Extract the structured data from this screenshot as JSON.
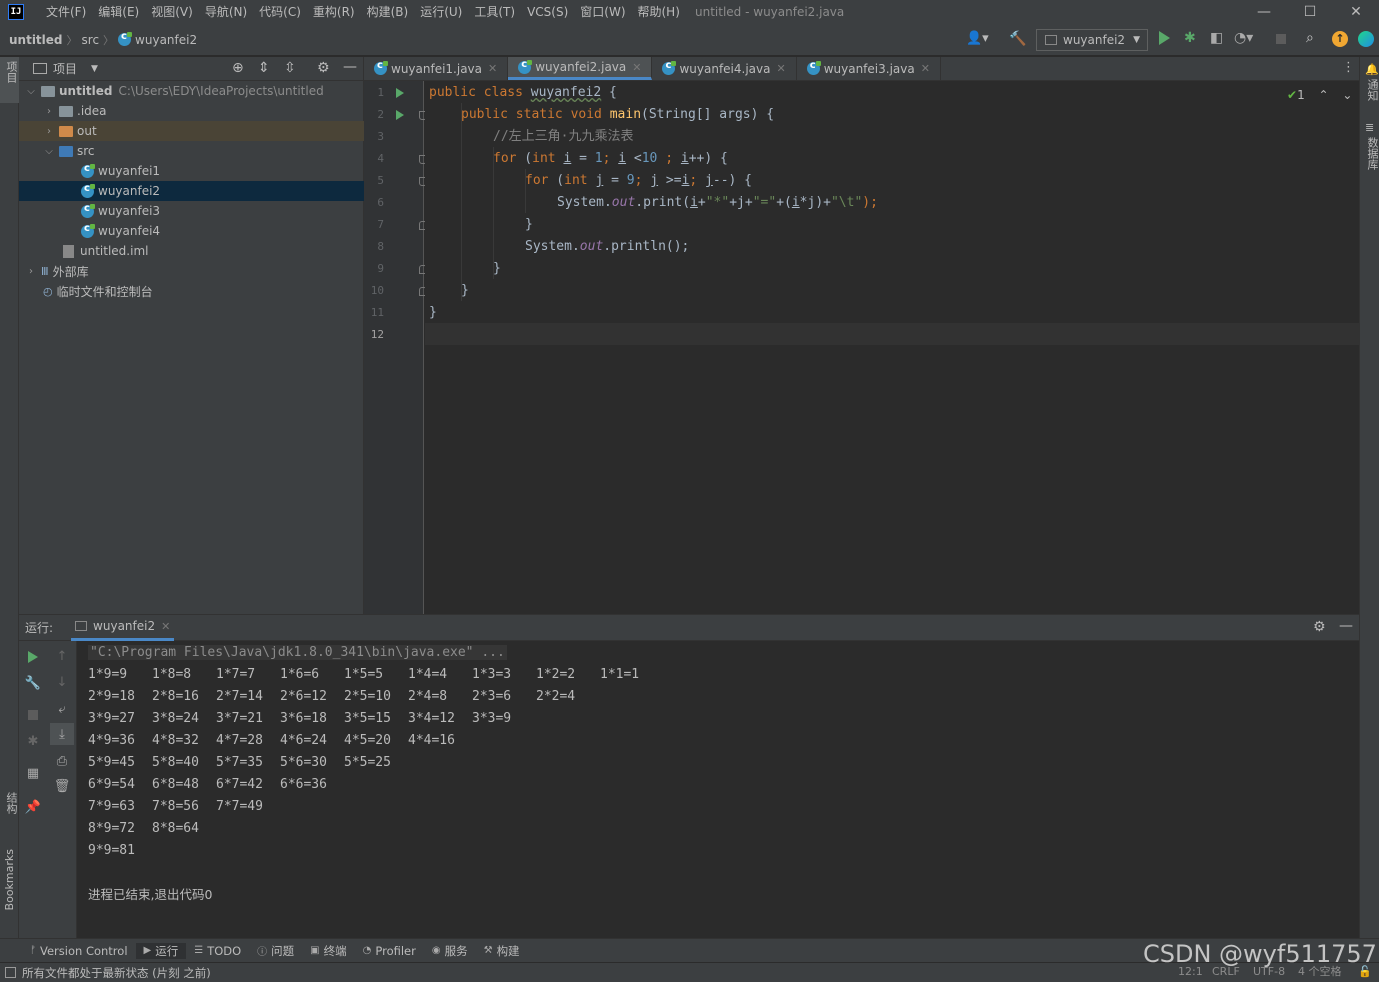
{
  "app": {
    "logo_text": "IJ",
    "window_title": "untitled - wuyanfei2.java"
  },
  "menu": [
    "文件(F)",
    "编辑(E)",
    "视图(V)",
    "导航(N)",
    "代码(C)",
    "重构(R)",
    "构建(B)",
    "运行(U)",
    "工具(T)",
    "VCS(S)",
    "窗口(W)",
    "帮助(H)"
  ],
  "breadcrumb": {
    "project": "untitled",
    "folder": "src",
    "file": "wuyanfei2"
  },
  "run_config": {
    "label": "wuyanfei2"
  },
  "stripes": {
    "left_top": "项目",
    "left_structure": "结构",
    "left_bookmarks": "Bookmarks",
    "right_notifications": "通知",
    "right_database": "数据库"
  },
  "project_panel": {
    "title": "项目",
    "tree": [
      {
        "label": "untitled",
        "path": "C:\\Users\\EDY\\IdeaProjects\\untitled"
      },
      {
        "label": ".idea"
      },
      {
        "label": "out"
      },
      {
        "label": "src"
      },
      {
        "label": "wuyanfei1"
      },
      {
        "label": "wuyanfei2"
      },
      {
        "label": "wuyanfei3"
      },
      {
        "label": "wuyanfei4"
      },
      {
        "label": "untitled.iml"
      },
      {
        "label": "外部库"
      },
      {
        "label": "临时文件和控制台"
      }
    ]
  },
  "editor": {
    "tabs": [
      "wuyanfei1.java",
      "wuyanfei2.java",
      "wuyanfei4.java",
      "wuyanfei3.java"
    ],
    "inspection_count": "1",
    "line_numbers": [
      "1",
      "2",
      "3",
      "4",
      "5",
      "6",
      "7",
      "8",
      "9",
      "10",
      "11",
      "12"
    ],
    "code": {
      "l1_kw": "public class ",
      "l1_name": "wuyanfei2",
      "l1_rest": " {",
      "l2_kw": "public static void ",
      "l2_fn": "main",
      "l2_rest": "(String[] args) {",
      "l3_comment": "//左上三角·九九乘法表",
      "l4_for": "for",
      "l4_a": " (",
      "l4_int": "int",
      "l4_b": " ",
      "l4_i1": "i",
      "l4_c": " = ",
      "l4_n1": "1",
      "l4_d": "; ",
      "l4_i2": "i",
      "l4_e": " <",
      "l4_n2": "10",
      "l4_f": " ; ",
      "l4_i3": "i",
      "l4_g": "++) {",
      "l5_for": "for",
      "l5_a": " (",
      "l5_int": "int",
      "l5_b": " ",
      "l5_j1": "j",
      "l5_c": " = ",
      "l5_n1": "9",
      "l5_d": "; ",
      "l5_j2": "j",
      "l5_e": " >=",
      "l5_i": "i",
      "l5_f": "; ",
      "l5_j3": "j",
      "l5_g": "--) {",
      "l6_sys": "System.",
      "l6_out": "out",
      "l6_print": ".print(",
      "l6_i": "i",
      "l6_p1": "+",
      "l6_s1": "\"*\"",
      "l6_p2": "+j+",
      "l6_s2": "\"=\"",
      "l6_p3": "+(",
      "l6_i2": "i",
      "l6_p4": "*j)+",
      "l6_s3": "\"\\t\"",
      "l6_end": ");",
      "l7": "}",
      "l8_sys": "System.",
      "l8_out": "out",
      "l8_rest": ".println();",
      "l9": "}",
      "l10": "}",
      "l11": "}"
    }
  },
  "run_panel": {
    "label": "运行:",
    "tab": "wuyanfei2",
    "command": "\"C:\\Program Files\\Java\\jdk1.8.0_341\\bin\\java.exe\" ...",
    "output": [
      [
        "1*9=9",
        "1*8=8",
        "1*7=7",
        "1*6=6",
        "1*5=5",
        "1*4=4",
        "1*3=3",
        "1*2=2",
        "1*1=1"
      ],
      [
        "2*9=18",
        "2*8=16",
        "2*7=14",
        "2*6=12",
        "2*5=10",
        "2*4=8",
        "2*3=6",
        "2*2=4"
      ],
      [
        "3*9=27",
        "3*8=24",
        "3*7=21",
        "3*6=18",
        "3*5=15",
        "3*4=12",
        "3*3=9"
      ],
      [
        "4*9=36",
        "4*8=32",
        "4*7=28",
        "4*6=24",
        "4*5=20",
        "4*4=16"
      ],
      [
        "5*9=45",
        "5*8=40",
        "5*7=35",
        "5*6=30",
        "5*5=25"
      ],
      [
        "6*9=54",
        "6*8=48",
        "6*7=42",
        "6*6=36"
      ],
      [
        "7*9=63",
        "7*8=56",
        "7*7=49"
      ],
      [
        "8*9=72",
        "8*8=64"
      ],
      [
        "9*9=81"
      ]
    ],
    "exit_message": "进程已结束,退出代码0"
  },
  "bottom_tools": [
    "Version Control",
    "运行",
    "TODO",
    "问题",
    "终端",
    "Profiler",
    "服务",
    "构建"
  ],
  "status": {
    "message": "所有文件都处于最新状态 (片刻 之前)",
    "position": "12:1",
    "line_sep": "CRLF",
    "encoding": "UTF-8",
    "indent": "4 个空格"
  },
  "watermark": "CSDN @wyf511757",
  "colors": {
    "keyword": "#cc7832",
    "function": "#ffc66d",
    "number": "#6897bb",
    "string": "#6a8759",
    "comment": "#808080",
    "field": "#9876aa",
    "selection": "#0d293e",
    "run_green": "#59a869"
  }
}
